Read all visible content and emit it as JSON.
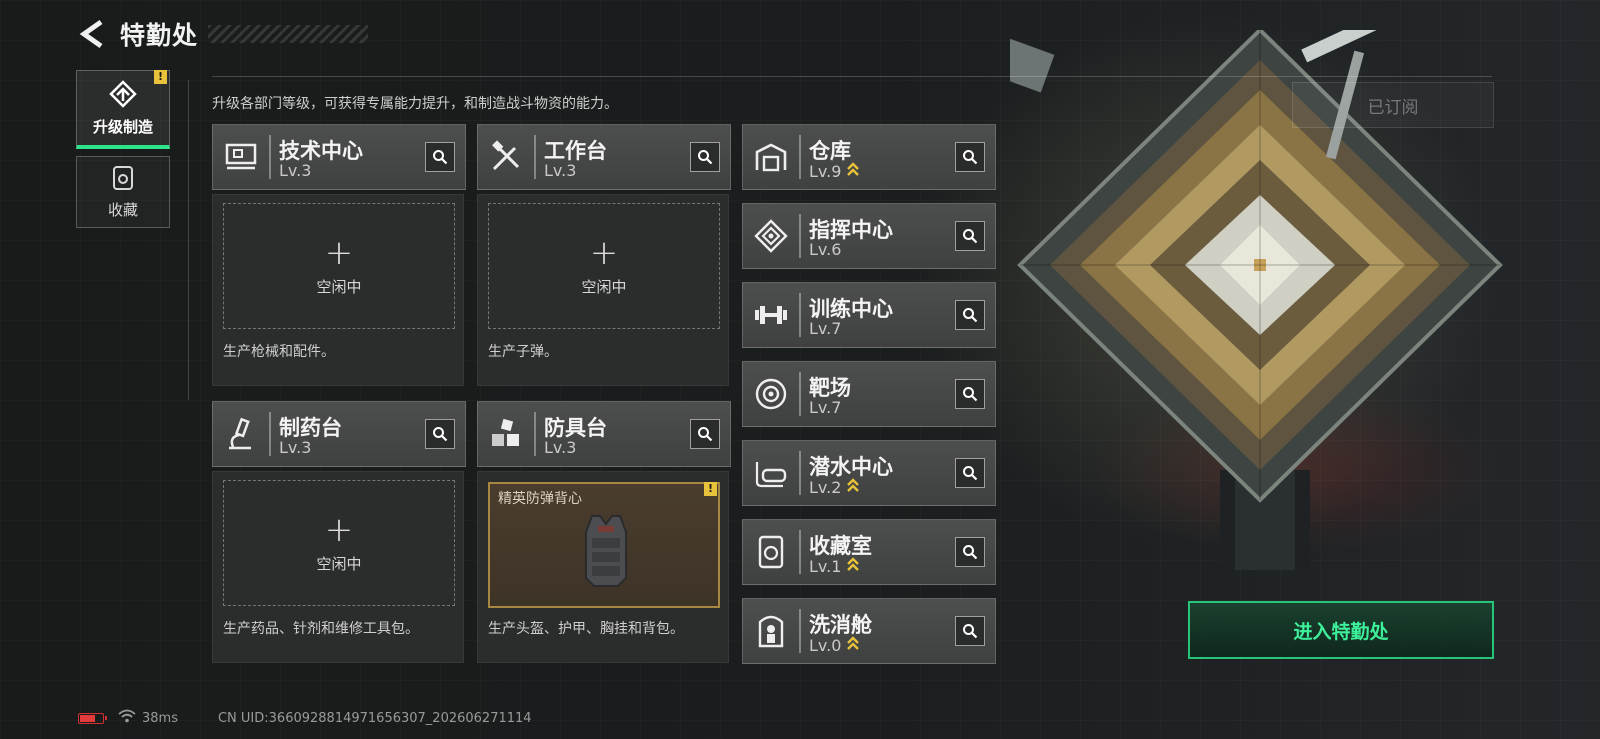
{
  "header": {
    "title": "特勤处"
  },
  "sidebar": {
    "tabs": [
      {
        "label": "升级制造",
        "active": true,
        "alert": "!"
      },
      {
        "label": "收藏",
        "active": false
      }
    ]
  },
  "description": "升级各部门等级，可获得专属能力提升，和制造战斗物资的能力。",
  "subscribed_label": "已订阅",
  "production": [
    {
      "name": "技术中心",
      "level": "Lv.3",
      "icon": "monitor-icon",
      "slot_label": "空闲中",
      "desc": "生产枪械和配件。"
    },
    {
      "name": "工作台",
      "level": "Lv.3",
      "icon": "tools-icon",
      "slot_label": "空闲中",
      "desc": "生产子弹。"
    },
    {
      "name": "制药台",
      "level": "Lv.3",
      "icon": "microscope-icon",
      "slot_label": "空闲中",
      "desc": "生产药品、针剂和维修工具包。"
    },
    {
      "name": "防具台",
      "level": "Lv.3",
      "icon": "armor-blocks-icon",
      "item_name": "精英防弹背心",
      "alert": "!",
      "desc": "生产头盔、护甲、胸挂和背包。"
    }
  ],
  "facilities": [
    {
      "name": "仓库",
      "level": "Lv.9",
      "upgradable": true,
      "icon": "warehouse-icon"
    },
    {
      "name": "指挥中心",
      "level": "Lv.6",
      "upgradable": false,
      "icon": "command-icon"
    },
    {
      "name": "训练中心",
      "level": "Lv.7",
      "upgradable": false,
      "icon": "dumbbell-icon"
    },
    {
      "name": "靶场",
      "level": "Lv.7",
      "upgradable": false,
      "icon": "target-icon"
    },
    {
      "name": "潜水中心",
      "level": "Lv.2",
      "upgradable": true,
      "icon": "diving-mask-icon"
    },
    {
      "name": "收藏室",
      "level": "Lv.1",
      "upgradable": true,
      "icon": "collection-icon"
    },
    {
      "name": "洗消舱",
      "level": "Lv.0",
      "upgradable": true,
      "icon": "decon-pod-icon"
    }
  ],
  "enter_button": "进入特勤处",
  "status": {
    "ping": "38ms",
    "uid": "CN UID:3660928814971656307_202606271114"
  },
  "colors": {
    "accent": "#2ee48a",
    "upgrade": "#e8c23a",
    "warning": "#e8c23a",
    "battery": "#e43c3c"
  }
}
